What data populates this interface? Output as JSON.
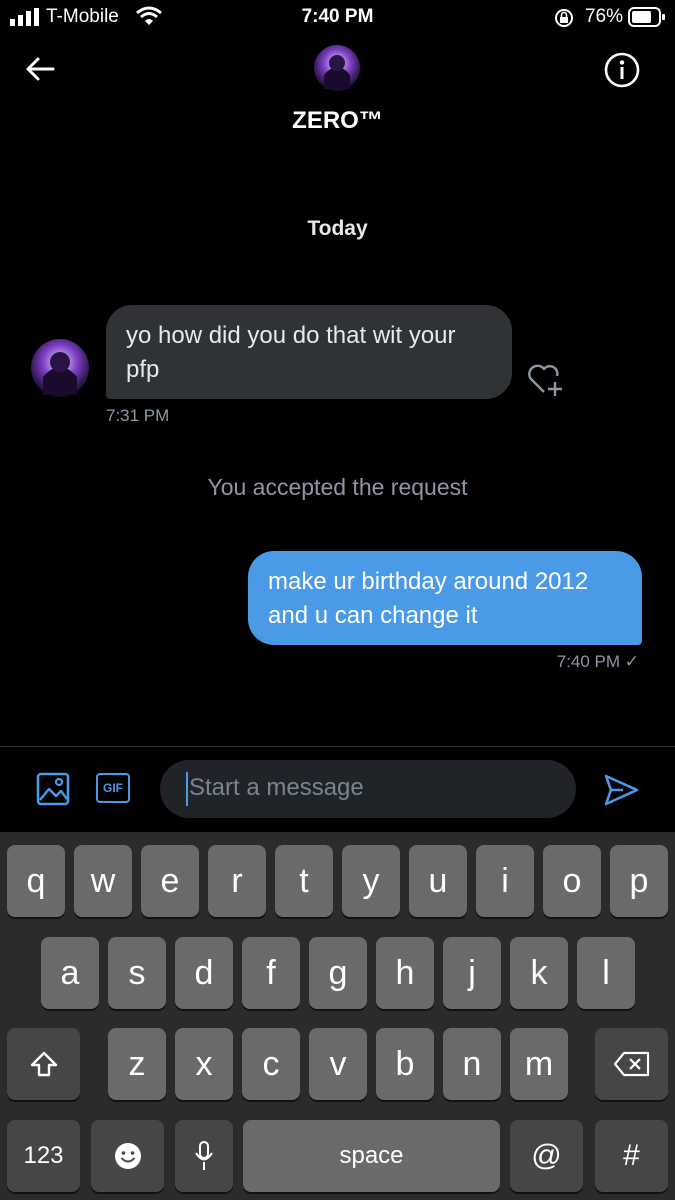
{
  "status_bar": {
    "carrier": "T-Mobile",
    "time": "7:40 PM",
    "battery": "76%"
  },
  "header": {
    "title": "ZERO™"
  },
  "chat": {
    "date_separator": "Today",
    "messages": [
      {
        "direction": "incoming",
        "text": "yo how did you do that wit your pfp",
        "time": "7:31 PM"
      },
      {
        "direction": "outgoing",
        "text": "make ur birthday around 2012 and u can change it",
        "time": "7:40 PM ✓"
      }
    ],
    "system_message": "You accepted the request"
  },
  "composer": {
    "gif_label": "GIF",
    "placeholder": "Start a message"
  },
  "keyboard": {
    "row1": [
      "q",
      "w",
      "e",
      "r",
      "t",
      "y",
      "u",
      "i",
      "o",
      "p"
    ],
    "row2": [
      "a",
      "s",
      "d",
      "f",
      "g",
      "h",
      "j",
      "k",
      "l"
    ],
    "row3": [
      "z",
      "x",
      "c",
      "v",
      "b",
      "n",
      "m"
    ],
    "numbers_key": "123",
    "space_key": "space",
    "at_key": "@",
    "hash_key": "#"
  },
  "colors": {
    "accent": "#4a9ae8",
    "background": "#000000",
    "incoming_bubble": "#2f3336"
  }
}
